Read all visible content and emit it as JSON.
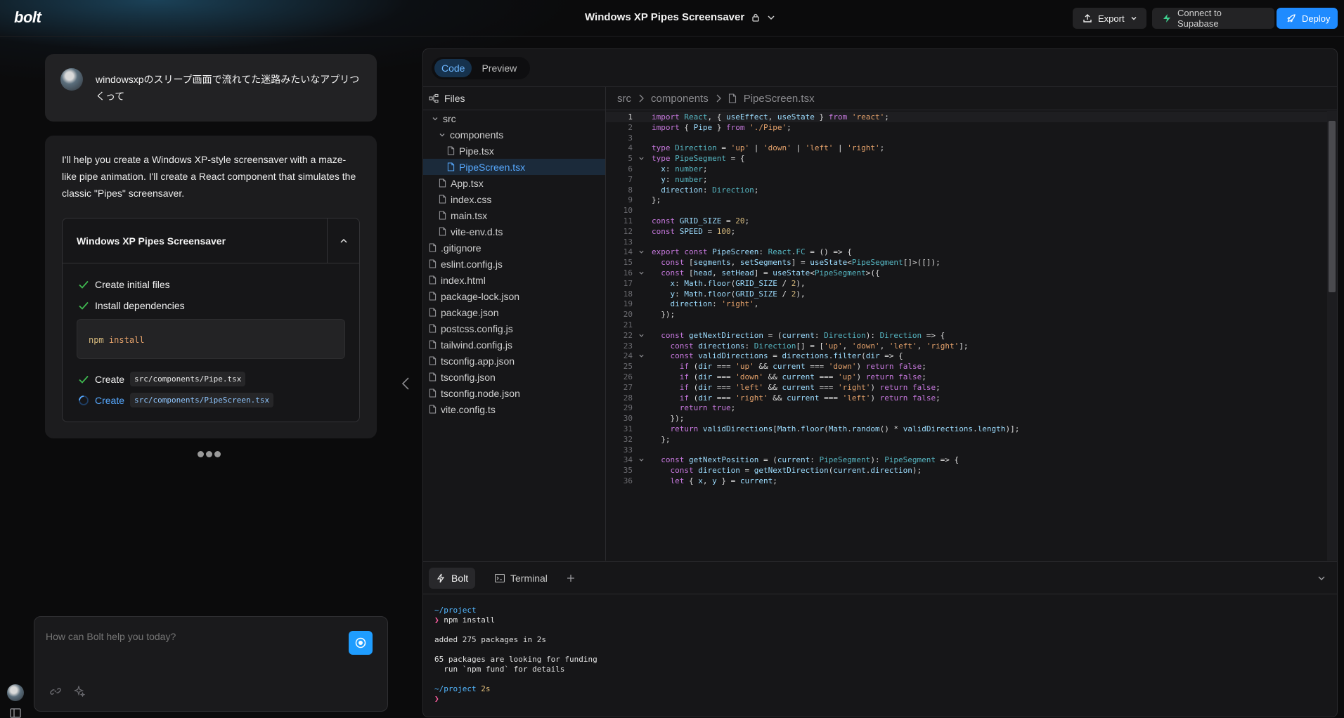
{
  "app": {
    "logo": "bolt",
    "project_title": "Windows XP Pipes Screensaver"
  },
  "header": {
    "export_label": "Export",
    "supabase_label": "Connect to Supabase",
    "deploy_label": "Deploy"
  },
  "chat": {
    "user_message": "windowsxpのスリープ画面で流れてた迷路みたいなアプリつくって",
    "ai_message": "I'll help you create a Windows XP-style screensaver with a maze-like pipe animation. I'll create a React component that simulates the classic \"Pipes\" screensaver.",
    "artifact": {
      "title": "Windows XP Pipes Screensaver",
      "steps": [
        {
          "label": "Create initial files",
          "status": "done"
        },
        {
          "label": "Install dependencies",
          "status": "done"
        },
        {
          "label": "Create",
          "file": "src/components/Pipe.tsx",
          "status": "done"
        },
        {
          "label": "Create",
          "file": "src/components/PipeScreen.tsx",
          "status": "running"
        }
      ],
      "npm_cmd": "npm",
      "npm_arg": "install"
    },
    "input_placeholder": "How can Bolt help you today?"
  },
  "workbench": {
    "tabs": [
      {
        "label": "Code",
        "active": true
      },
      {
        "label": "Preview",
        "active": false
      }
    ],
    "files_label": "Files",
    "tree": [
      {
        "label": "src",
        "type": "folder"
      },
      {
        "label": "components",
        "type": "folder"
      },
      {
        "label": "Pipe.tsx",
        "type": "file"
      },
      {
        "label": "PipeScreen.tsx",
        "type": "file",
        "selected": true
      },
      {
        "label": "App.tsx",
        "type": "file"
      },
      {
        "label": "index.css",
        "type": "file"
      },
      {
        "label": "main.tsx",
        "type": "file"
      },
      {
        "label": "vite-env.d.ts",
        "type": "file"
      },
      {
        "label": ".gitignore",
        "type": "file"
      },
      {
        "label": "eslint.config.js",
        "type": "file"
      },
      {
        "label": "index.html",
        "type": "file"
      },
      {
        "label": "package-lock.json",
        "type": "file"
      },
      {
        "label": "package.json",
        "type": "file"
      },
      {
        "label": "postcss.config.js",
        "type": "file"
      },
      {
        "label": "tailwind.config.js",
        "type": "file"
      },
      {
        "label": "tsconfig.app.json",
        "type": "file"
      },
      {
        "label": "tsconfig.json",
        "type": "file"
      },
      {
        "label": "tsconfig.node.json",
        "type": "file"
      },
      {
        "label": "vite.config.ts",
        "type": "file"
      }
    ],
    "breadcrumb": [
      "src",
      "components",
      "PipeScreen.tsx"
    ],
    "code_lines": [
      "import React, { useEffect, useState } from 'react';",
      "import { Pipe } from './Pipe';",
      "",
      "type Direction = 'up' | 'down' | 'left' | 'right';",
      "type PipeSegment = {",
      "  x: number;",
      "  y: number;",
      "  direction: Direction;",
      "};",
      "",
      "const GRID_SIZE = 20;",
      "const SPEED = 100;",
      "",
      "export const PipeScreen: React.FC = () => {",
      "  const [segments, setSegments] = useState<PipeSegment[]>([]);",
      "  const [head, setHead] = useState<PipeSegment>({",
      "    x: Math.floor(GRID_SIZE / 2),",
      "    y: Math.floor(GRID_SIZE / 2),",
      "    direction: 'right',",
      "  });",
      "",
      "  const getNextDirection = (current: Direction): Direction => {",
      "    const directions: Direction[] = ['up', 'down', 'left', 'right'];",
      "    const validDirections = directions.filter(dir => {",
      "      if (dir === 'up' && current === 'down') return false;",
      "      if (dir === 'down' && current === 'up') return false;",
      "      if (dir === 'left' && current === 'right') return false;",
      "      if (dir === 'right' && current === 'left') return false;",
      "      return true;",
      "    });",
      "    return validDirections[Math.floor(Math.random() * validDirections.length)];",
      "  };",
      "",
      "  const getNextPosition = (current: PipeSegment): PipeSegment => {",
      "    const direction = getNextDirection(current.direction);",
      "    let { x, y } = current;"
    ],
    "fold_lines": [
      4,
      13,
      15,
      21,
      23,
      33
    ],
    "terminal": {
      "tabs": [
        {
          "label": "Bolt",
          "active": true
        },
        {
          "label": "Terminal",
          "active": false
        }
      ],
      "lines": [
        {
          "parts": [
            {
              "text": "~/project",
              "color": "cyan"
            }
          ]
        },
        {
          "parts": [
            {
              "text": "❯ ",
              "color": "pink"
            },
            {
              "text": "npm install",
              "color": ""
            }
          ]
        },
        {
          "parts": [
            {
              "text": "",
              "color": ""
            }
          ]
        },
        {
          "parts": [
            {
              "text": "added 275 packages in 2s",
              "color": ""
            }
          ]
        },
        {
          "parts": [
            {
              "text": "",
              "color": ""
            }
          ]
        },
        {
          "parts": [
            {
              "text": "65 packages are looking for funding",
              "color": ""
            }
          ]
        },
        {
          "parts": [
            {
              "text": "  run `npm fund` for details",
              "color": ""
            }
          ]
        },
        {
          "parts": [
            {
              "text": "",
              "color": ""
            }
          ]
        },
        {
          "parts": [
            {
              "text": "~/project",
              "color": "cyan"
            },
            {
              "text": " 2s",
              "color": "yel"
            }
          ]
        },
        {
          "parts": [
            {
              "text": "❯",
              "color": "pink"
            }
          ]
        }
      ]
    }
  },
  "colors": {
    "accent": "#1f8bff",
    "selected": "#57a9ff",
    "success": "#3fb950"
  }
}
